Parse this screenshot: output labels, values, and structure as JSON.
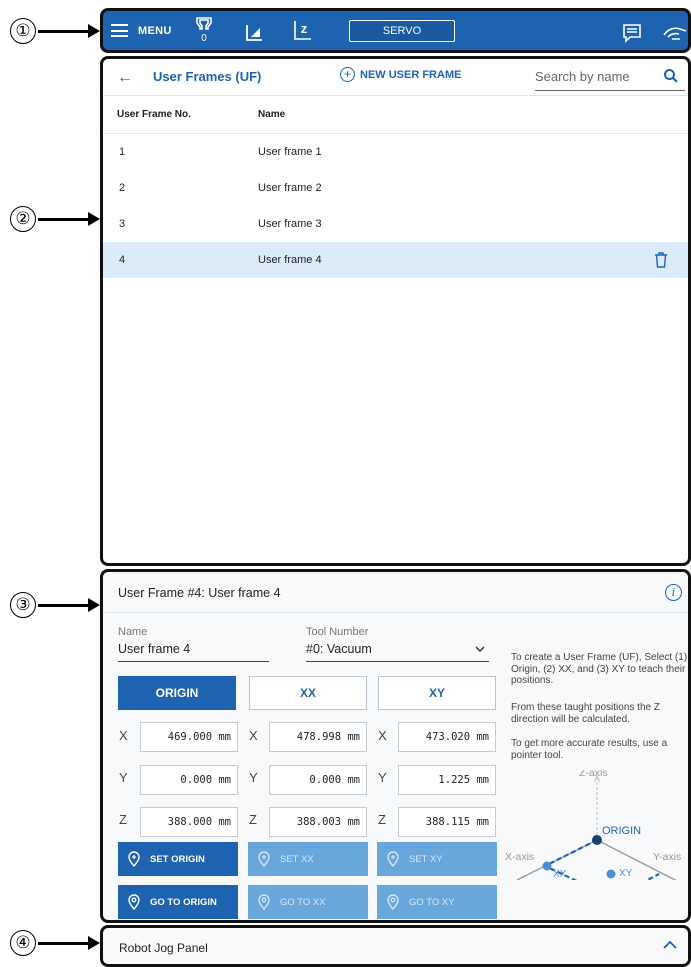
{
  "callouts": [
    "①",
    "②",
    "③",
    "④"
  ],
  "topbar": {
    "menu_label": "MENU",
    "tool_badge": "0",
    "servo_label": "SERVO",
    "icons": [
      "gripper-icon",
      "frame-l-icon",
      "frame-z-icon",
      "message-icon",
      "teach-hand-icon"
    ],
    "color": "#1e63b0"
  },
  "list": {
    "title": "User Frames (UF)",
    "new_button": "NEW USER FRAME",
    "search_placeholder": "Search by name",
    "columns": [
      "User Frame No.",
      "Name"
    ],
    "rows": [
      {
        "no": "1",
        "name": "User frame 1"
      },
      {
        "no": "2",
        "name": "User frame 2"
      },
      {
        "no": "3",
        "name": "User frame 3"
      },
      {
        "no": "4",
        "name": "User frame 4"
      }
    ],
    "selected_index": 3
  },
  "config": {
    "title": "User Frame #4: User frame 4",
    "name_label": "Name",
    "name_value": "User frame 4",
    "tool_label": "Tool Number",
    "tool_value": "#0: Vacuum",
    "tabs": [
      "ORIGIN",
      "XX",
      "XY"
    ],
    "active_tab": "ORIGIN",
    "axes": [
      "X",
      "Y",
      "Z"
    ],
    "values": {
      "origin": [
        "469.000 mm",
        "0.000 mm",
        "388.000 mm"
      ],
      "xx": [
        "478.998 mm",
        "0.000 mm",
        "388.003 mm"
      ],
      "xy": [
        "473.020 mm",
        "1.225 mm",
        "388.115 mm"
      ]
    },
    "set_buttons": [
      "SET ORIGIN",
      "SET XX",
      "SET XY"
    ],
    "goto_buttons": [
      "GO TO ORIGIN",
      "GO TO XX",
      "GO TO XY"
    ],
    "help": [
      "To create a User Frame (UF), Select (1) Origin, (2) XX, and (3) XY to teach their positions.",
      "From these taught positions the Z direction will be calculated.",
      "To get more accurate results, use a pointer tool."
    ],
    "diagram": {
      "z_axis": "Z-axis",
      "x_axis": "X-axis",
      "y_axis": "Y-axis",
      "origin": "ORIGIN",
      "xx": "XX",
      "xy": "XY"
    }
  },
  "jog": {
    "title": "Robot Jog Panel"
  }
}
